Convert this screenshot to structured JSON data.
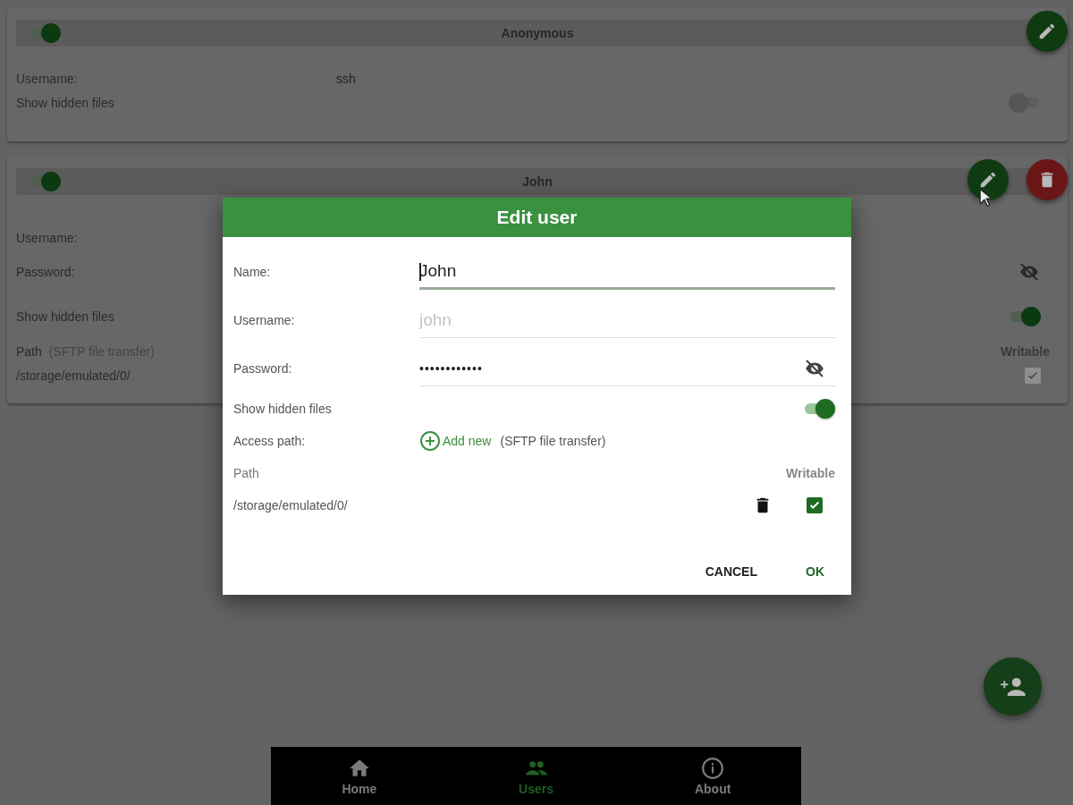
{
  "cards": [
    {
      "name": "Anonymous",
      "enabled": true,
      "actions": [
        {
          "kind": "edit"
        }
      ],
      "rows": [
        {
          "kind": "text",
          "label": "Username:",
          "value": "ssh"
        },
        {
          "kind": "toggle",
          "label": "Show hidden files",
          "on": false
        }
      ]
    },
    {
      "name": "John",
      "enabled": true,
      "actions": [
        {
          "kind": "edit"
        },
        {
          "kind": "delete"
        }
      ],
      "rows": [
        {
          "kind": "text",
          "label": "Username:"
        },
        {
          "kind": "password",
          "label": "Password:"
        },
        {
          "kind": "toggle",
          "label": "Show hidden files",
          "on": true
        },
        {
          "kind": "paths",
          "label": "Path",
          "note": "(SFTP file transfer)",
          "column": "Writable",
          "paths": [
            {
              "path": "/storage/emulated/0/",
              "writable": true
            }
          ]
        }
      ]
    }
  ],
  "dialog": {
    "title": "Edit user",
    "fields": [
      {
        "kind": "text",
        "label": "Name:",
        "value": "John",
        "focused": true
      },
      {
        "kind": "text",
        "label": "Username:",
        "placeholder": "john",
        "focused": false
      },
      {
        "kind": "password",
        "label": "Password:",
        "value": "••••••••••••",
        "focused": false
      }
    ],
    "show_hidden": {
      "label": "Show hidden files",
      "on": true
    },
    "access_path": {
      "label": "Access path:",
      "add": "Add new",
      "note": "(SFTP file transfer)"
    },
    "paths": {
      "column_path": "Path",
      "column_writable": "Writable",
      "rows": [
        {
          "path": "/storage/emulated/0/",
          "writable": true
        }
      ]
    },
    "buttons": [
      {
        "kind": "cancel",
        "label": "CANCEL"
      },
      {
        "kind": "ok",
        "label": "OK"
      }
    ]
  },
  "nav": [
    {
      "kind": "home",
      "label": "Home",
      "selected": false
    },
    {
      "kind": "users",
      "label": "Users",
      "selected": true
    },
    {
      "kind": "info",
      "label": "About",
      "selected": false
    }
  ]
}
